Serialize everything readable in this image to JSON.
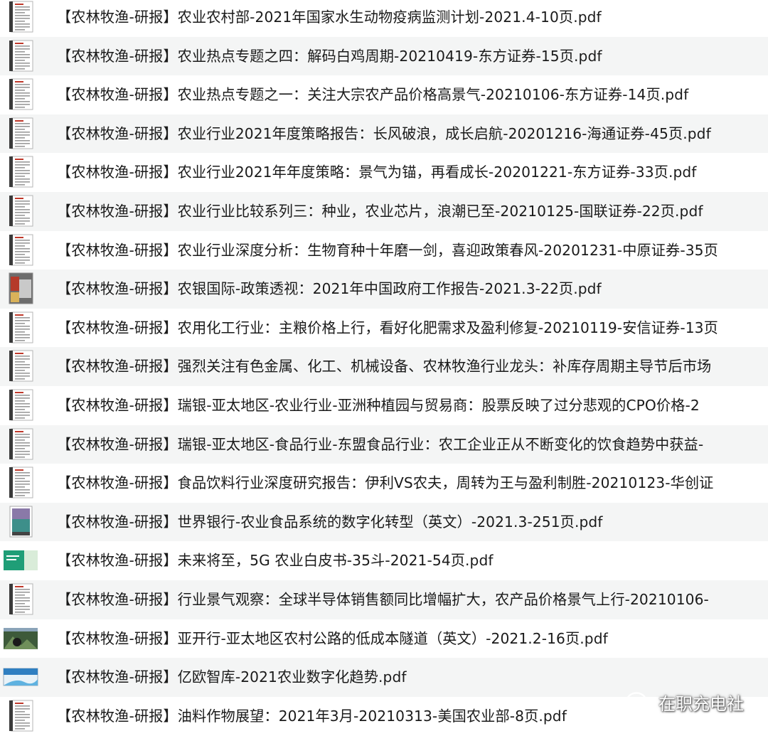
{
  "files": [
    {
      "name": "【农林牧渔-研报】农业农村部-2021年国家水生动物疫病监测计划-2021.4-10页.pdf",
      "icon": "pdf-document-icon"
    },
    {
      "name": "【农林牧渔-研报】农业热点专题之四：解码白鸡周期-20210419-东方证券-15页.pdf",
      "icon": "pdf-document-icon"
    },
    {
      "name": "【农林牧渔-研报】农业热点专题之一：关注大宗农产品价格高景气-20210106-东方证券-14页.pdf",
      "icon": "pdf-document-icon"
    },
    {
      "name": "【农林牧渔-研报】农业行业2021年度策略报告：长风破浪，成长启航-20201216-海通证券-45页.pdf",
      "icon": "pdf-document-icon"
    },
    {
      "name": "【农林牧渔-研报】农业行业2021年年度策略：景气为锚，再看成长-20201221-东方证券-33页.pdf",
      "icon": "pdf-document-icon"
    },
    {
      "name": "【农林牧渔-研报】农业行业比较系列三：种业，农业芯片，浪潮已至-20210125-国联证券-22页.pdf",
      "icon": "pdf-document-icon"
    },
    {
      "name": "【农林牧渔-研报】农业行业深度分析：生物育种十年磨一剑，喜迎政策春风-20201231-中原证券-35页",
      "icon": "pdf-document-icon"
    },
    {
      "name": "【农林牧渔-研报】农银国际-政策透视：2021年中国政府工作报告-2021.3-22页.pdf",
      "icon": "pdf-photo-cover-icon"
    },
    {
      "name": "【农林牧渔-研报】农用化工行业：主粮价格上行，看好化肥需求及盈利修复-20210119-安信证券-13页",
      "icon": "pdf-document-icon"
    },
    {
      "name": "【农林牧渔-研报】强烈关注有色金属、化工、机械设备、农林牧渔行业龙头：补库存周期主导节后市场",
      "icon": "pdf-document-icon"
    },
    {
      "name": "【农林牧渔-研报】瑞银-亚太地区-农业行业-亚洲种植园与贸易商：股票反映了过分悲观的CPO价格-2",
      "icon": "pdf-document-icon"
    },
    {
      "name": "【农林牧渔-研报】瑞银-亚太地区-食品行业-东盟食品行业：农工企业正从不断变化的饮食趋势中获益-",
      "icon": "pdf-document-icon"
    },
    {
      "name": "【农林牧渔-研报】食品饮料行业深度研究报告：伊利VS农夫，周转为王与盈利制胜-20210123-华创证",
      "icon": "pdf-document-icon"
    },
    {
      "name": "【农林牧渔-研报】世界银行-农业食品系统的数字化转型（英文）-2021.3-251页.pdf",
      "icon": "pdf-color-cover-icon"
    },
    {
      "name": "【农林牧渔-研报】未来将至，5G 农业白皮书-35斗-2021-54页.pdf",
      "icon": "pdf-green-slide-icon"
    },
    {
      "name": "【农林牧渔-研报】行业景气观察：全球半导体销售额同比增幅扩大，农产品价格景气上行-20210106-",
      "icon": "pdf-document-icon"
    },
    {
      "name": "【农林牧渔-研报】亚开行-亚太地区农村公路的低成本隧道（英文）-2021.2-16页.pdf",
      "icon": "pdf-photo-slide-icon"
    },
    {
      "name": "【农林牧渔-研报】亿欧智库-2021农业数字化趋势.pdf",
      "icon": "pdf-blue-slide-icon"
    },
    {
      "name": "【农林牧渔-研报】油料作物展望：2021年3月-20210313-美国农业部-8页.pdf",
      "icon": "pdf-document-icon"
    }
  ],
  "watermark": {
    "text": "在职充电社",
    "icon": "wechat-icon"
  }
}
